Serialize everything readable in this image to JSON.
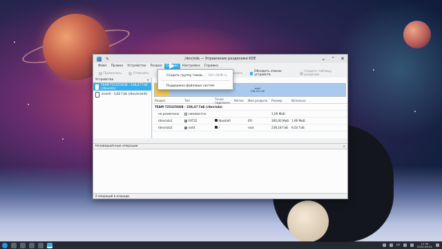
{
  "window": {
    "title": "/dev/sda — Управление разделами KDE",
    "controls": [
      "chevron-down-icon",
      "chevron-up-icon",
      "close-icon"
    ]
  },
  "menubar": {
    "items": [
      "Файл",
      "Правка",
      "Устройство",
      "Раздел",
      "Сервис",
      "Настройка",
      "Справка"
    ],
    "active": "Сервис"
  },
  "toolbar": {
    "apply": "Применить",
    "undo": "Отменить",
    "resize": "Удалить",
    "refresh": "Обновить список устройств",
    "new_table": "Создать таблицу разделов"
  },
  "devices_pane": {
    "header": "Устройства",
    "items": [
      {
        "label": "TEAM T253256GB - 238,47 ГиБ (/dev/sda)",
        "selected": true
      },
      {
        "label": "zram0 - 3,82 ГиБ (/dev/zram0)",
        "selected": false
      }
    ]
  },
  "disk_map": {
    "segment_label": "sda2",
    "segment_size": "238,18 ГиБ"
  },
  "partition_table": {
    "headers": [
      "Раздел",
      "Тип",
      "Точка подключе",
      "Метка",
      "Имя раздела",
      "Размер",
      "Использо"
    ],
    "disk_row": "TEAM T253256GB - 238,47 ГиБ (/dev/sda)",
    "rows": [
      {
        "partition": "не размечено",
        "type": "неизвестно",
        "locked": false,
        "mount": "",
        "label": "",
        "name": "",
        "size": "1,00 МиБ",
        "used": "",
        "swatch": "#d9d9d9"
      },
      {
        "partition": "/dev/sda1",
        "type": "FAT32",
        "locked": true,
        "mount": "/boot/efi",
        "label": "",
        "name": "EFI",
        "size": "300,00 МиБ",
        "used": "1,96 МиБ",
        "swatch": "#6fbf5a"
      },
      {
        "partition": "/dev/sda2",
        "type": "ext4",
        "locked": true,
        "mount": "/",
        "label": "",
        "name": "root",
        "size": "238,18 ГиБ",
        "used": "9,54 ГиБ",
        "swatch": "#5b7fd6"
      }
    ]
  },
  "operations_pane": {
    "header": "Незавершённые операции"
  },
  "statusbar": {
    "text": "0 операций в очереди"
  },
  "dropdown": {
    "items": [
      {
        "label": "Создать группу томов…",
        "shortcut": "Ctrl+Shift+L"
      },
      {
        "label": "Поддержка файловых систем",
        "shortcut": ""
      }
    ]
  },
  "taskbar": {
    "tray": {
      "layout": "us",
      "time": "12:39",
      "date": "2024-09-01"
    }
  }
}
